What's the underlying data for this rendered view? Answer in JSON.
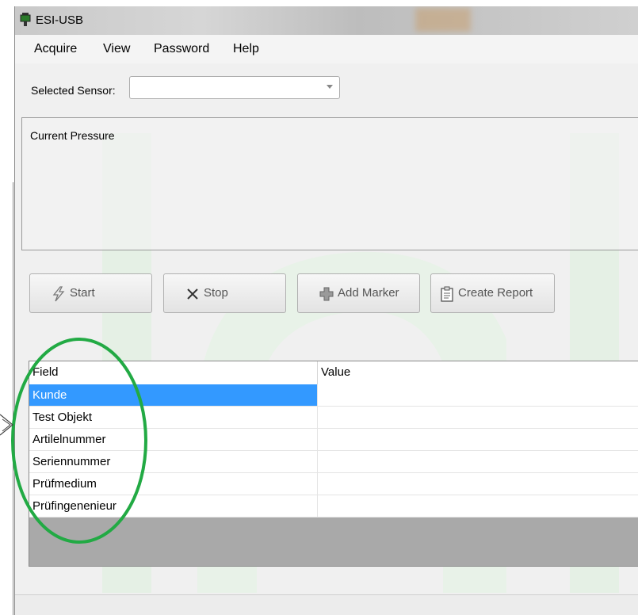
{
  "window": {
    "title": "ESI-USB"
  },
  "menu": [
    "Acquire",
    "View",
    "Password",
    "Help"
  ],
  "sensor": {
    "label": "Selected Sensor:",
    "value": ""
  },
  "pressure": {
    "label": "Current Pressure"
  },
  "buttons": {
    "start": "Start",
    "stop": "Stop",
    "add_marker": "Add Marker",
    "create_report": "Create Report"
  },
  "grid": {
    "columns": [
      "Field",
      "Value"
    ],
    "rows": [
      {
        "field": "Kunde",
        "value": ""
      },
      {
        "field": "Test Objekt",
        "value": ""
      },
      {
        "field": "Artilelnummer",
        "value": ""
      },
      {
        "field": "Seriennummer",
        "value": ""
      },
      {
        "field": "Prüfmedium",
        "value": ""
      },
      {
        "field": "Prüfingenenieur",
        "value": ""
      }
    ],
    "selected_row": 0
  },
  "colors": {
    "selection": "#3399ff",
    "annotation_circle": "#22aa44",
    "watermark": "#e3efe3"
  }
}
